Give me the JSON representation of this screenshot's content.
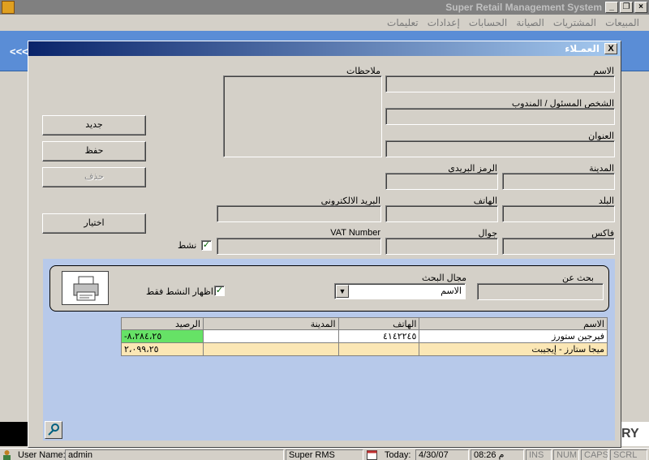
{
  "app": {
    "title": "Super Retail Management System",
    "menu": [
      "المبيعات",
      "المشتريات",
      "الصيانة",
      "الحسابات",
      "إعدادات",
      "تعليمات"
    ],
    "nav_arrows": "<<<",
    "brand_fragment": "RY"
  },
  "dialog": {
    "title": "العمـلاء",
    "close_label": "X",
    "labels": {
      "name": "الاسم",
      "notes": "ملاحظات",
      "contact": "الشخص المسئول / المندوب",
      "address": "العنوان",
      "city": "المدينة",
      "postal": "الرمز البريدي",
      "country": "البلد",
      "phone": "الهاتف",
      "email": "البريد الالكتروني",
      "fax": "فاكس",
      "mobile": "جوال",
      "vat": "VAT Number",
      "active": "نشط"
    },
    "active_checked": true,
    "buttons": {
      "new": "جديد",
      "save": "حفظ",
      "delete": "حذف",
      "select": "اختيار"
    },
    "search": {
      "search_for_label": "بحث عن",
      "search_field_label": "مجال البحث",
      "search_field_value": "الاسم",
      "show_active_label": "اظهار النشط فقط",
      "show_active_checked": true
    },
    "grid": {
      "columns": [
        "الاسم",
        "الهاتف",
        "المدينة",
        "الرصيد"
      ],
      "rows": [
        {
          "name": "فيرجين ستورز",
          "phone": "٤١٤٢٢٤٥",
          "city": "",
          "balance": "-٨،٢٨٤،٢٥"
        },
        {
          "name": "ميجا ستارز - إيجيبت",
          "phone": "",
          "city": "",
          "balance": "٢،٠٩٩،٢٥"
        }
      ]
    }
  },
  "statusbar": {
    "user_label": "User Name:",
    "user_value": "admin",
    "app_name": "Super RMS",
    "today_label": "Today:",
    "date": "4/30/07",
    "time": "08:26 م",
    "ins": "INS",
    "num": "NUM",
    "caps": "CAPS",
    "scrl": "SCRL"
  },
  "colors": {
    "dialog_title_start": "#0a246a",
    "dialog_title_end": "#a6caf0",
    "positive_balance": "#66e266",
    "row_alt": "#fbe7b5",
    "lower_panel": "#b7c9ea"
  }
}
